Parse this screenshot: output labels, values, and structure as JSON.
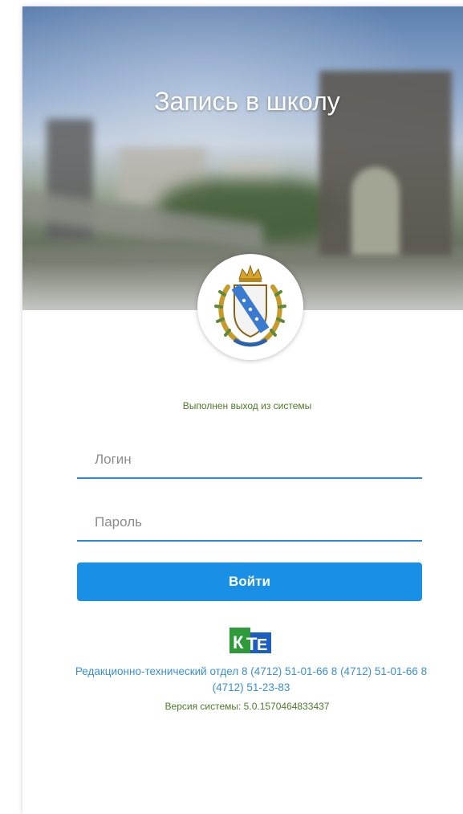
{
  "header": {
    "title": "Запись в школу"
  },
  "emblem": {
    "icon": "kursk-coat-of-arms-icon"
  },
  "status": {
    "message": "Выполнен выход из системы",
    "color": "#4e7a2a"
  },
  "form": {
    "login_placeholder": "Логин",
    "login_value": "",
    "password_placeholder": "Пароль",
    "password_value": "",
    "submit_label": "Войти"
  },
  "footer": {
    "logo_text": "КТЕ",
    "contact_text": "Редакционно-технический отдел 8 (4712) 51-01-66  8 (4712) 51-01-66  8 (4712) 51-23-83",
    "version_text": "Версия системы: 5.0.1570464833437"
  },
  "colors": {
    "accent": "#1a8fe6",
    "link": "#3a8fd6",
    "status": "#4e7a2a"
  }
}
